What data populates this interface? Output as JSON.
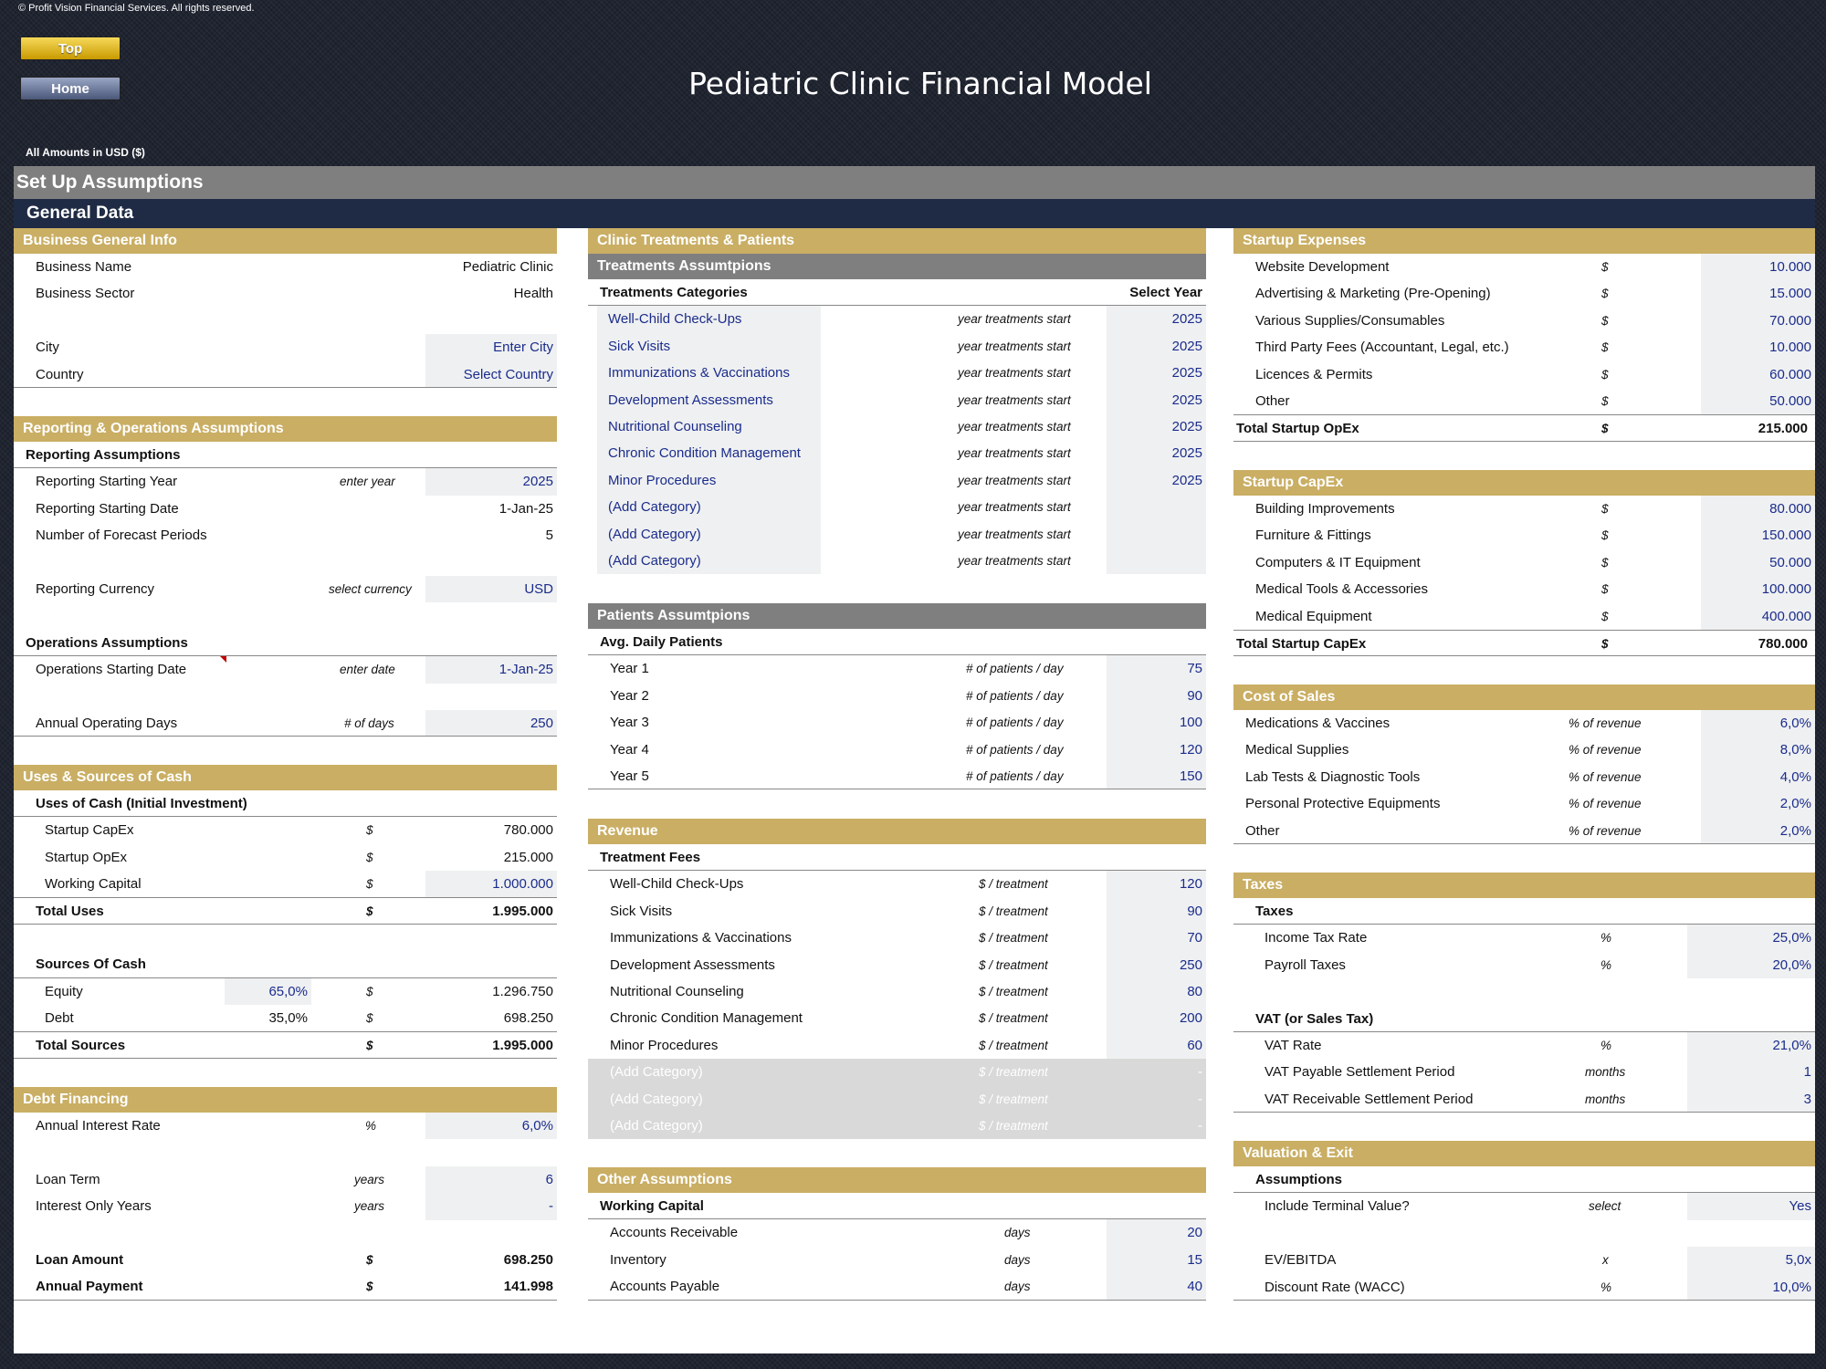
{
  "copyright": "© Profit Vision Financial Services. All rights reserved.",
  "nav": {
    "top": "Top",
    "home": "Home"
  },
  "title": "Pediatric Clinic Financial Model",
  "amounts_label": "All Amounts in  USD ($)",
  "setup_title": "Set Up Assumptions",
  "general_title": "General Data",
  "business": {
    "title": "Business General Info",
    "name_label": "Business Name",
    "name_value": "Pediatric Clinic",
    "sector_label": "Business Sector",
    "sector_value": "Health",
    "city_label": "City",
    "city_value": "Enter City",
    "country_label": "Country",
    "country_value": "Select Country"
  },
  "reporting": {
    "title": "Reporting & Operations Assumptions",
    "rep_header": "Reporting Assumptions",
    "start_year_label": "Reporting Starting Year",
    "start_year_unit": "enter year",
    "start_year_value": "2025",
    "start_date_label": "Reporting Starting Date",
    "start_date_value": "1-Jan-25",
    "periods_label": "Number of Forecast Periods",
    "periods_value": "5",
    "currency_label": "Reporting Currency",
    "currency_unit": "select currency",
    "currency_value": "USD",
    "ops_header": "Operations Assumptions",
    "ops_date_label": "Operations Starting Date",
    "ops_date_unit": "enter date",
    "ops_date_value": "1-Jan-25",
    "days_label": "Annual Operating Days",
    "days_unit": "# of days",
    "days_value": "250"
  },
  "uses": {
    "title": "Uses & Sources of Cash",
    "uses_header": "Uses of Cash (Initial Investment)",
    "capex_label": "Startup CapEx",
    "capex_value": "780.000",
    "opex_label": "Startup OpEx",
    "opex_value": "215.000",
    "wc_label": "Working Capital",
    "wc_value": "1.000.000",
    "total_uses_label": "Total Uses",
    "total_uses_value": "1.995.000",
    "sources_header": "Sources Of Cash",
    "equity_label": "Equity",
    "equity_pct": "65,0%",
    "equity_value": "1.296.750",
    "debt_label": "Debt",
    "debt_pct": "35,0%",
    "debt_value": "698.250",
    "total_sources_label": "Total Sources",
    "total_sources_value": "1.995.000",
    "currency": "$"
  },
  "debt": {
    "title": "Debt Financing",
    "rate_label": "Annual Interest Rate",
    "rate_unit": "%",
    "rate_value": "6,0%",
    "term_label": "Loan Term",
    "term_unit": "years",
    "term_value": "6",
    "io_label": "Interest Only Years",
    "io_unit": "years",
    "io_value": "-",
    "amount_label": "Loan Amount",
    "amount_unit": "$",
    "amount_value": "698.250",
    "payment_label": "Annual Payment",
    "payment_unit": "$",
    "payment_value": "141.998"
  },
  "treatments": {
    "title": "Clinic Treatments & Patients",
    "sub_title": "Treatments Assumtpions",
    "cat_header": "Treatments Categories",
    "year_header": "Select Year",
    "unit": "year treatments start",
    "items": [
      {
        "name": "Well-Child Check-Ups",
        "year": "2025"
      },
      {
        "name": "Sick Visits",
        "year": "2025"
      },
      {
        "name": "Immunizations & Vaccinations",
        "year": "2025"
      },
      {
        "name": "Development Assessments",
        "year": "2025"
      },
      {
        "name": "Nutritional Counseling",
        "year": "2025"
      },
      {
        "name": "Chronic Condition Management",
        "year": "2025"
      },
      {
        "name": "Minor Procedures",
        "year": "2025"
      },
      {
        "name": "(Add Category)",
        "year": ""
      },
      {
        "name": "(Add Category)",
        "year": ""
      },
      {
        "name": "(Add Category)",
        "year": ""
      }
    ]
  },
  "patients": {
    "sub_title": "Patients Assumtpions",
    "header": "Avg. Daily Patients",
    "unit": "# of patients / day",
    "items": [
      {
        "label": "Year 1",
        "value": "75"
      },
      {
        "label": "Year 2",
        "value": "90"
      },
      {
        "label": "Year 3",
        "value": "100"
      },
      {
        "label": "Year 4",
        "value": "120"
      },
      {
        "label": "Year 5",
        "value": "150"
      }
    ]
  },
  "revenue": {
    "title": "Revenue",
    "header": "Treatment Fees",
    "unit": "$ / treatment",
    "items": [
      {
        "label": "Well-Child Check-Ups",
        "value": "120"
      },
      {
        "label": "Sick Visits",
        "value": "90"
      },
      {
        "label": "Immunizations & Vaccinations",
        "value": "70"
      },
      {
        "label": "Development Assessments",
        "value": "250"
      },
      {
        "label": "Nutritional Counseling",
        "value": "80"
      },
      {
        "label": "Chronic Condition Management",
        "value": "200"
      },
      {
        "label": "Minor Procedures",
        "value": "60"
      },
      {
        "label": "(Add Category)",
        "value": "-"
      },
      {
        "label": "(Add Category)",
        "value": "-"
      },
      {
        "label": "(Add Category)",
        "value": "-"
      }
    ]
  },
  "other": {
    "title": "Other Assumptions",
    "header": "Working Capital",
    "unit": "days",
    "items": [
      {
        "label": "Accounts Receivable",
        "value": "20"
      },
      {
        "label": "Inventory",
        "value": "15"
      },
      {
        "label": "Accounts Payable",
        "value": "40"
      }
    ]
  },
  "startup_opex": {
    "title": "Startup Expenses",
    "currency": "$",
    "items": [
      {
        "label": "Website Development",
        "value": "10.000"
      },
      {
        "label": "Advertising & Marketing (Pre-Opening)",
        "value": "15.000"
      },
      {
        "label": "Various Supplies/Consumables",
        "value": "70.000"
      },
      {
        "label": "Third Party Fees (Accountant, Legal, etc.)",
        "value": "10.000"
      },
      {
        "label": "Licences & Permits",
        "value": "60.000"
      },
      {
        "label": "Other",
        "value": "50.000"
      }
    ],
    "total_label": "Total Startup OpEx",
    "total_value": "215.000"
  },
  "startup_capex": {
    "title": "Startup CapEx",
    "currency": "$",
    "items": [
      {
        "label": "Building Improvements",
        "value": "80.000"
      },
      {
        "label": "Furniture & Fittings",
        "value": "150.000"
      },
      {
        "label": "Computers & IT Equipment",
        "value": "50.000"
      },
      {
        "label": "Medical Tools & Accessories",
        "value": "100.000"
      },
      {
        "label": "Medical Equipment",
        "value": "400.000"
      }
    ],
    "total_label": "Total Startup CapEx",
    "total_value": "780.000"
  },
  "cos": {
    "title": "Cost of Sales",
    "unit": "% of revenue",
    "items": [
      {
        "label": "Medications & Vaccines",
        "value": "6,0%"
      },
      {
        "label": "Medical Supplies",
        "value": "8,0%"
      },
      {
        "label": "Lab Tests & Diagnostic Tools",
        "value": "4,0%"
      },
      {
        "label": "Personal Protective Equipments",
        "value": "2,0%"
      },
      {
        "label": "Other",
        "value": "2,0%"
      }
    ]
  },
  "taxes": {
    "title": "Taxes",
    "header": "Taxes",
    "income_label": "Income Tax Rate",
    "income_unit": "%",
    "income_value": "25,0%",
    "payroll_label": "Payroll Taxes",
    "payroll_unit": "%",
    "payroll_value": "20,0%",
    "vat_header": "VAT (or Sales Tax)",
    "vat_label": "VAT Rate",
    "vat_unit": "%",
    "vat_value": "21,0%",
    "vatpay_label": "VAT Payable Settlement Period",
    "vatpay_unit": "months",
    "vatpay_value": "1",
    "vatrec_label": "VAT Receivable Settlement Period",
    "vatrec_unit": "months",
    "vatrec_value": "3"
  },
  "valuation": {
    "title": "Valuation & Exit",
    "header": "Assumptions",
    "tv_label": "Include Terminal Value?",
    "tv_unit": "select",
    "tv_value": "Yes",
    "ev_label": "EV/EBITDA",
    "ev_unit": "x",
    "ev_value": "5,0x",
    "wacc_label": "Discount Rate (WACC)",
    "wacc_unit": "%",
    "wacc_value": "10,0%"
  }
}
